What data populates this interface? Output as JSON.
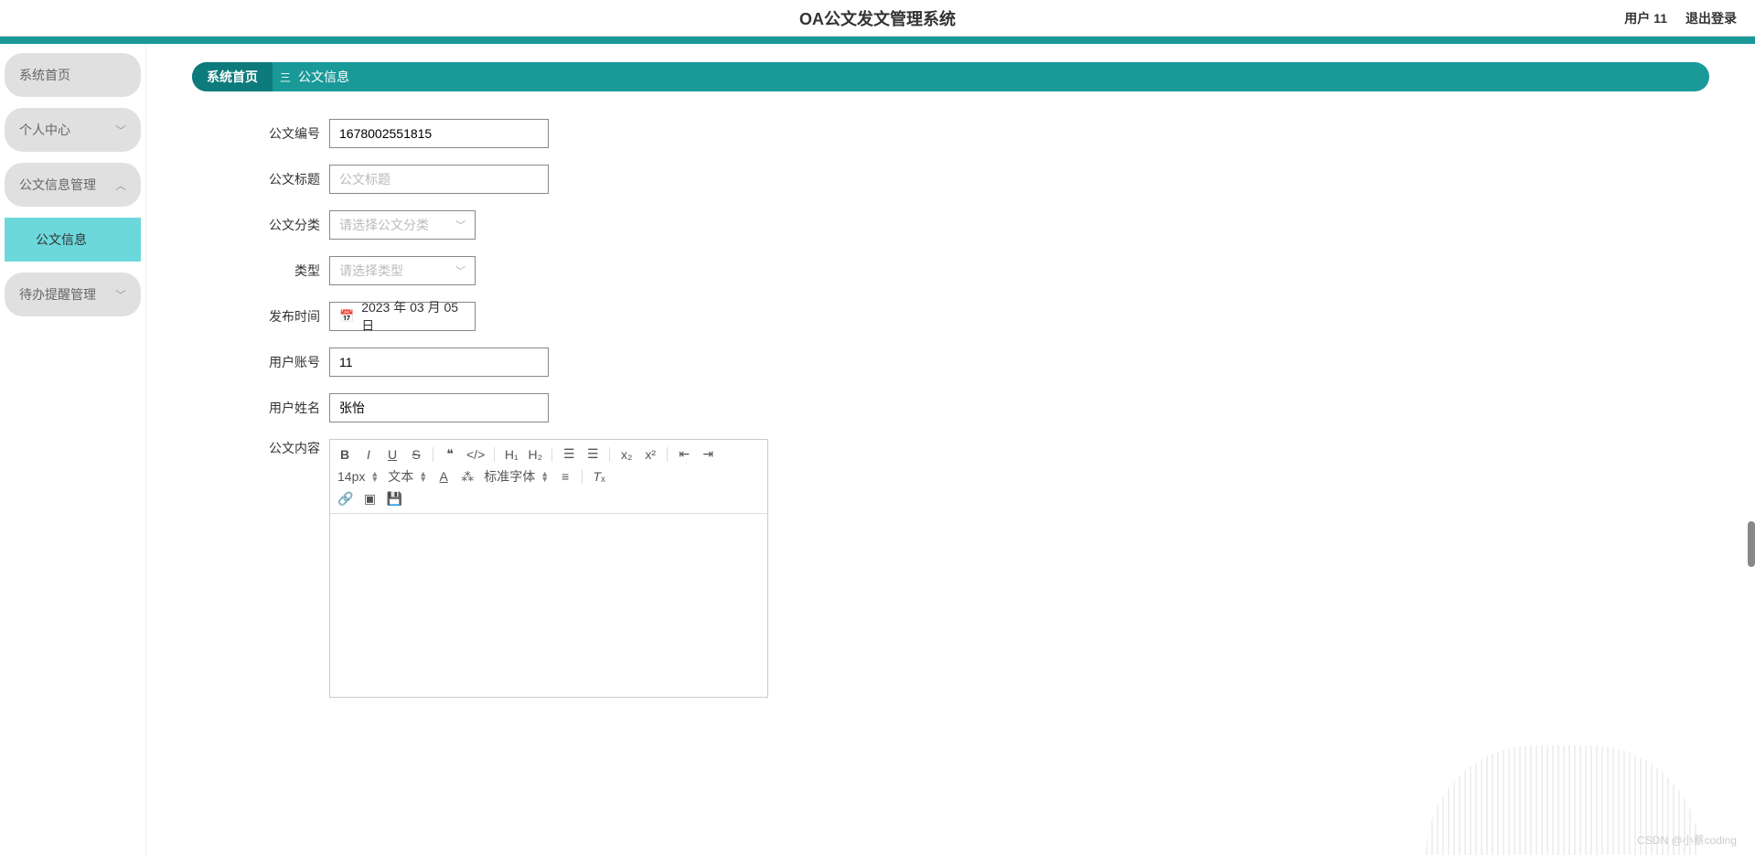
{
  "header": {
    "title": "OA公文发文管理系统",
    "user_label": "用户 11",
    "logout_label": "退出登录"
  },
  "sidebar": {
    "items": [
      {
        "label": "系统首页",
        "expandable": false
      },
      {
        "label": "个人中心",
        "expandable": true
      },
      {
        "label": "公文信息管理",
        "expandable": true,
        "expanded": true
      },
      {
        "label": "待办提醒管理",
        "expandable": true
      }
    ],
    "subitem": {
      "label": "公文信息"
    }
  },
  "breadcrumb": {
    "home": "系统首页",
    "separator": "三",
    "current": "公文信息"
  },
  "form": {
    "doc_no": {
      "label": "公文编号",
      "value": "1678002551815"
    },
    "doc_title": {
      "label": "公文标题",
      "value": "",
      "placeholder": "公文标题"
    },
    "doc_category": {
      "label": "公文分类",
      "placeholder": "请选择公文分类"
    },
    "doc_type": {
      "label": "类型",
      "placeholder": "请选择类型"
    },
    "publish_time": {
      "label": "发布时间",
      "value": "2023 年 03 月 05 日"
    },
    "user_account": {
      "label": "用户账号",
      "value": "11"
    },
    "user_name": {
      "label": "用户姓名",
      "value": "张怡"
    },
    "doc_content": {
      "label": "公文内容"
    }
  },
  "editor": {
    "font_size": "14px",
    "paragraph": "文本",
    "font_family": "标准字体"
  },
  "watermark": "CSDN @小蔡coding"
}
